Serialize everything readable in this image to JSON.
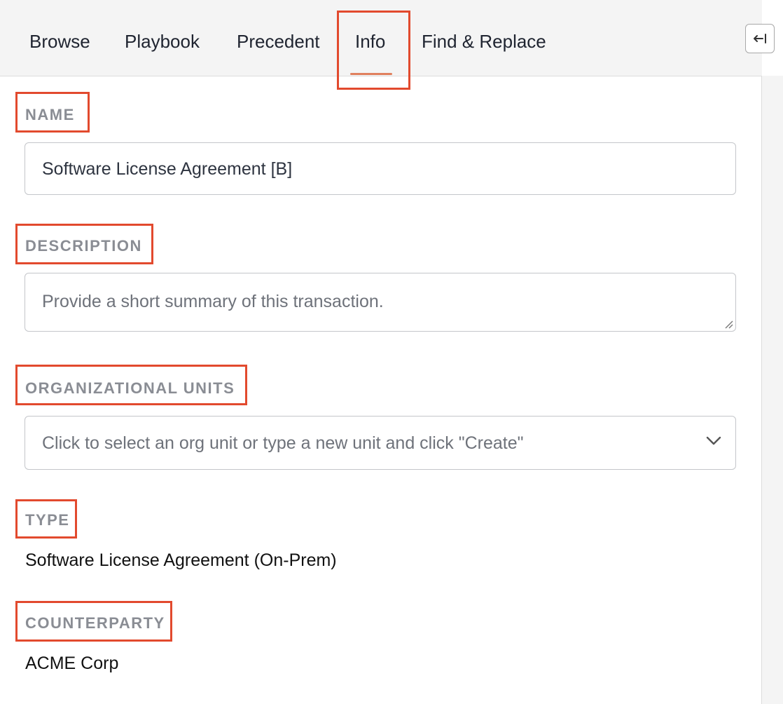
{
  "tabs": {
    "browse": "Browse",
    "playbook": "Playbook",
    "precedent": "Precedent",
    "info": "Info",
    "find_replace": "Find & Replace",
    "active": "Info"
  },
  "collapse_button": {
    "icon": "collapse-left-arrow-icon"
  },
  "sections": {
    "name": {
      "label": "NAME",
      "value": "Software License Agreement [B]"
    },
    "description": {
      "label": "DESCRIPTION",
      "placeholder": "Provide a short summary of this transaction."
    },
    "org_units": {
      "label": "ORGANIZATIONAL UNITS",
      "placeholder": "Click to select an org unit or type a new unit and click \"Create\""
    },
    "type": {
      "label": "TYPE",
      "value": "Software License Agreement (On-Prem)"
    },
    "counterparty": {
      "label": "COUNTERPARTY",
      "value": "ACME Corp"
    }
  },
  "colors": {
    "accent_underline": "#e0805e",
    "highlight_box": "#e24a2e",
    "label_gray": "#8a8d94",
    "tabbar_bg": "#f4f4f4"
  }
}
